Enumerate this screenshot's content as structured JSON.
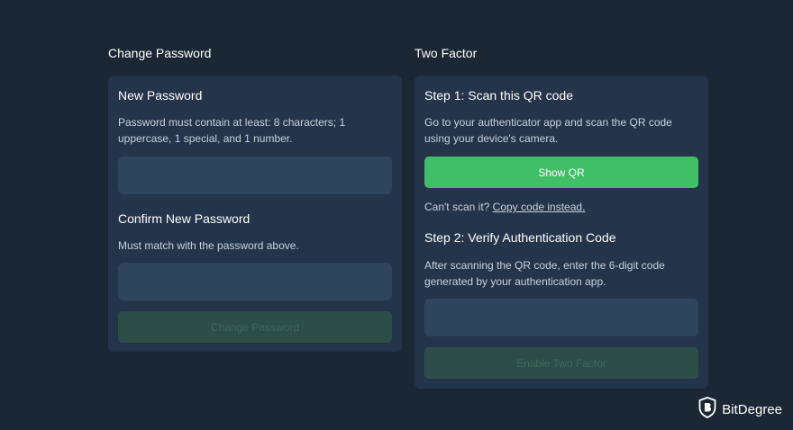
{
  "change_password": {
    "section_title": "Change Password",
    "new_password": {
      "heading": "New Password",
      "description": "Password must contain at least: 8 characters; 1 uppercase, 1 special, and 1 number.",
      "value": ""
    },
    "confirm_password": {
      "heading": "Confirm New Password",
      "description": "Must match with the password above.",
      "value": ""
    },
    "submit_label": "Change Password"
  },
  "two_factor": {
    "section_title": "Two Factor",
    "step1": {
      "heading": "Step 1: Scan this QR code",
      "description": "Go to your authenticator app and scan the QR code using your device's camera.",
      "show_qr_label": "Show QR",
      "cant_scan_text": "Can't scan it?",
      "copy_code_link": "Copy code instead."
    },
    "step2": {
      "heading": "Step 2: Verify Authentication Code",
      "description": "After scanning the QR code, enter the 6-digit code generated by your authentication app.",
      "code_value": ""
    },
    "enable_label": "Enable Two Factor"
  },
  "watermark": {
    "brand": "BitDegree",
    "icon": "bitdegree-shield-logo"
  },
  "colors": {
    "background": "#1b2734",
    "card": "#24344a",
    "input": "#2f445d",
    "accent_green": "#40bf67",
    "disabled_button": "#2c4d48"
  }
}
